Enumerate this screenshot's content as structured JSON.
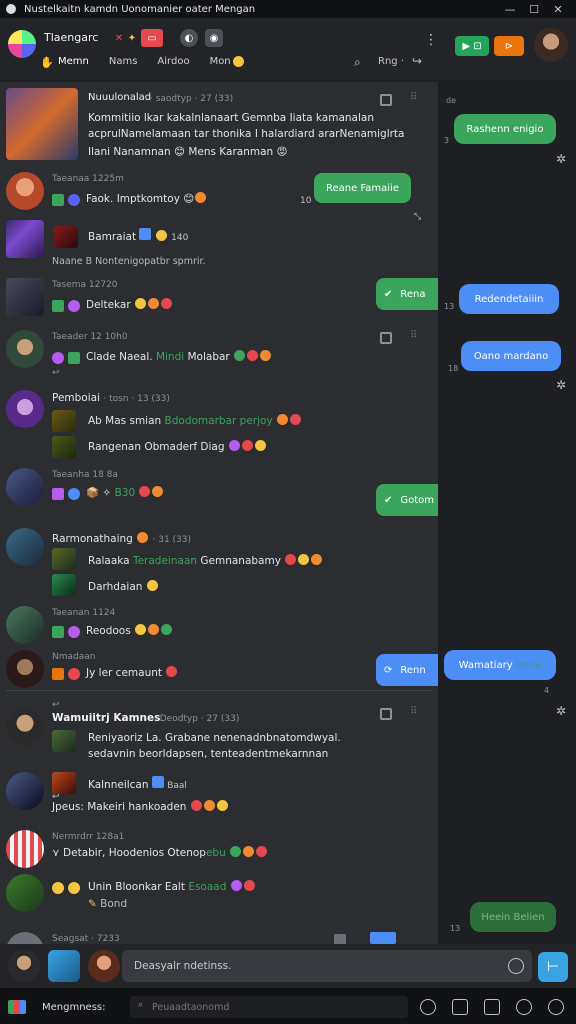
{
  "window": {
    "title": "Nustelkaitn kamdn Uonomanier oater Mengan",
    "controls": [
      "—",
      "☐",
      "✕"
    ]
  },
  "header": {
    "channel_name": "Tlaengarc",
    "tabs": [
      "Memn",
      "Nams",
      "Airdoo",
      "Mon"
    ],
    "right_text": "Rng ·",
    "badge_green": "▶ ⊡",
    "badge_orange": "⊳"
  },
  "messages": [
    {
      "author": "Nuuulonalad",
      "meta": "· saodtyp · 27 (33)",
      "lines": [
        "Kommitiio lkar kakalnlanaart Gemnba Iiata kamanalan",
        "acprulNamelamaan tar thonika I halardiard ararNenamiglrta",
        "Ilani Nanamnan 😊 Mens Karanman 😡"
      ]
    },
    {
      "meta": "Taeanaa 1225m",
      "text": "Faok. Imptkomtoy 😊"
    },
    {
      "author": "Bamraiat",
      "meta": "140",
      "text": "Naane  B Nontenigopatbr spmrir."
    },
    {
      "meta": "Tasema 12720",
      "text": "Deltekar"
    },
    {
      "meta": "Taeader 12 10h0",
      "text": "Clade Naeal.",
      "green": "Mindi",
      "after": "Molabar"
    },
    {
      "author": "Pemboiai",
      "meta": "· tosn · 13 (33)",
      "lines": [
        "Ab Mas smian",
        "Rangenan Obmaderf Diag"
      ],
      "green": "Bdodomarbar perjoy"
    },
    {
      "meta": "Taeanha 18 8a",
      "text": "📦 ✧",
      "green": "B30"
    },
    {
      "author": "Rarmonathaing",
      "meta": "· 31 (33)",
      "lines": [
        "Ralaaka",
        "Darhdaian"
      ],
      "green": "Teradeinaan",
      "after": "Gemnanabamy"
    },
    {
      "meta": "Taeanan 1124",
      "text": "Reodoos"
    },
    {
      "meta": "Nmadaan",
      "text": "Jy ler cemaunt"
    },
    {
      "author": "Wamuiitrj Kamnes",
      "meta": "· Deodtyp · 27 (33)",
      "lines": [
        "Reniyaoriz La. Grabane nenenadnbnatomdwyal.",
        "sedavnin beorldapsen, tenteadentmekarnnan"
      ]
    },
    {
      "author": "Kalnneilcan",
      "meta": "Baal",
      "text": "Jpeus: Makeiri hankoaden"
    },
    {
      "meta": "Nermrdrr 128a1",
      "text": "Detabir, Hoodenios Otenop",
      "green": "ebu"
    },
    {
      "text": "Unin Bloonkar Ealt",
      "green": "Esoaad",
      "sub": "Bond"
    },
    {
      "meta": "Seagsat · 7233"
    }
  ],
  "side_buttons": {
    "green": [
      "Rena",
      "Gotom"
    ],
    "blue": [
      "Renn"
    ]
  },
  "list_bubbles": [
    {
      "label": "Reane Famaiie",
      "number": "10"
    }
  ],
  "right_panel": {
    "bubbles": [
      {
        "label": "Rashenn enigio",
        "number": "3",
        "color": "green"
      },
      {
        "label": "Redendetaiiin",
        "number": "13",
        "color": "blue"
      },
      {
        "label": "Oano mardano",
        "number": "18",
        "color": "blue"
      },
      {
        "label": "Wamatiary",
        "green": "beria",
        "number": "4",
        "color": "blue"
      },
      {
        "label": "Heein Belien",
        "number": "13",
        "color": "dim"
      }
    ],
    "top_label": "de"
  },
  "composer": {
    "placeholder": "Deasyalr ndetinss."
  },
  "bottombar": {
    "label": "Mengmness:",
    "search_placeholder": "Peuaadtaonomd"
  },
  "colors": {
    "green": "#3ba55c",
    "blue": "#4c8df6",
    "orange": "#e8750e",
    "background": "#2b2d31"
  }
}
